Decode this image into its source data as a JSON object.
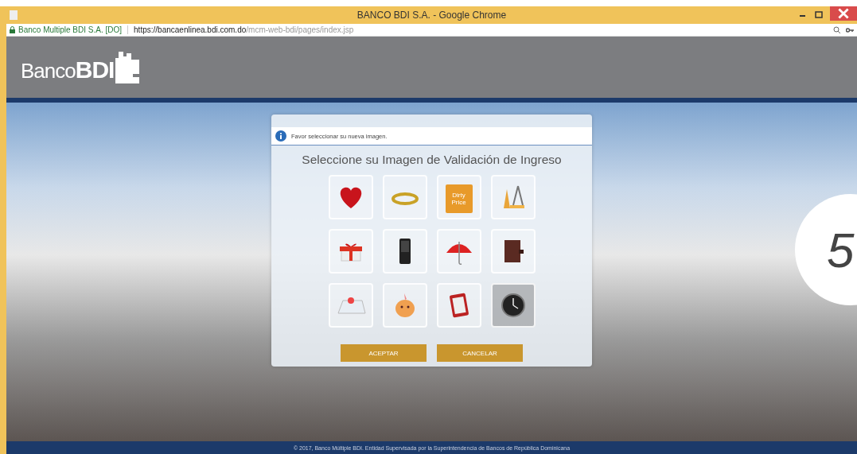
{
  "window": {
    "title": "BANCO BDI S.A. - Google Chrome"
  },
  "address_bar": {
    "site_identity": "Banco Multiple BDI S.A. [DO]",
    "url_host": "https://bancaenlinea.bdi.com.do",
    "url_path": "/mcm-web-bdi/pages/index.jsp"
  },
  "header": {
    "logo_light": "Banco",
    "logo_bold": "BDI"
  },
  "dialog": {
    "info": "Favor seleccionar su nueva imagen.",
    "title": "Seleccione su Imagen de Validación de Ingreso",
    "images": [
      {
        "selected": false
      },
      {
        "selected": false
      },
      {
        "selected": false,
        "label": "Dirty Price"
      },
      {
        "selected": false
      },
      {
        "selected": false
      },
      {
        "selected": false
      },
      {
        "selected": false
      },
      {
        "selected": false
      },
      {
        "selected": false
      },
      {
        "selected": false
      },
      {
        "selected": false
      },
      {
        "selected": true
      }
    ],
    "buttons": [
      "ACEPTAR",
      "CANCELAR"
    ]
  },
  "step_badge": "5",
  "footer": "© 2017, Banco Múltiple BDI. Entidad Supervisada por la Superintendencia de Bancos de República Dominicana"
}
